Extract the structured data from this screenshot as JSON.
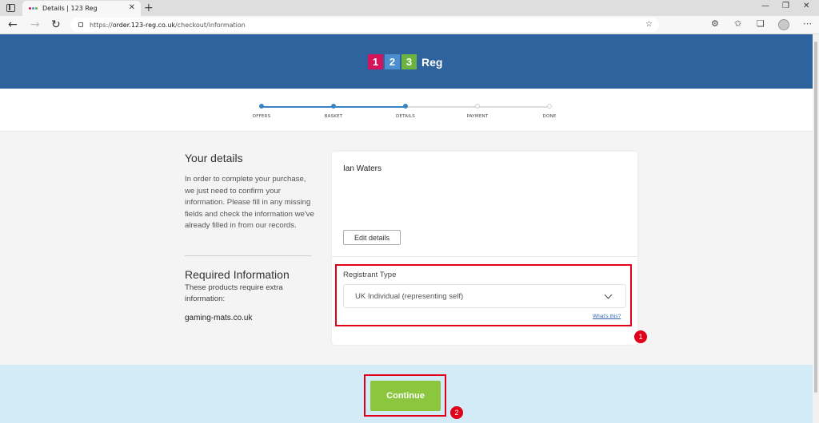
{
  "browser": {
    "tab_title": "Details | 123 Reg",
    "tab_close": "✕",
    "new_tab": "+",
    "url_scheme": "https://",
    "url_host": "order.123-reg.co.uk",
    "url_path": "/checkout/information",
    "win_min": "—",
    "win_restore": "❐",
    "win_close": "✕",
    "back": "←",
    "forward": "→",
    "refresh": "↻",
    "more": "⋯"
  },
  "logo": {
    "d1": "1",
    "d2": "2",
    "d3": "3",
    "word": "Reg"
  },
  "steps": [
    {
      "label": "OFFERS",
      "done": true
    },
    {
      "label": "BASKET",
      "done": true
    },
    {
      "label": "DETAILS",
      "done": true
    },
    {
      "label": "PAYMENT",
      "done": false
    },
    {
      "label": "DONE",
      "done": false
    }
  ],
  "details": {
    "heading": "Your details",
    "text": "In order to complete your purchase, we just need to confirm your information. Please fill in any missing fields and check the information we've already filled in from our records.",
    "name": "Ian Waters",
    "edit_label": "Edit details"
  },
  "required": {
    "heading": "Required Information",
    "text": "These products require extra information:",
    "domain": "gaming-mats.co.uk"
  },
  "registrant": {
    "label": "Registrant Type",
    "selected": "UK Individual (representing self)",
    "help_link": "What's this?"
  },
  "continue_label": "Continue",
  "annotations": {
    "badge1": "1",
    "badge2": "2"
  },
  "colors": {
    "header_blue": "#2f639d",
    "step_active": "#3a84c4",
    "continue_green": "#8cc63f",
    "highlight_red": "#e0001a"
  }
}
